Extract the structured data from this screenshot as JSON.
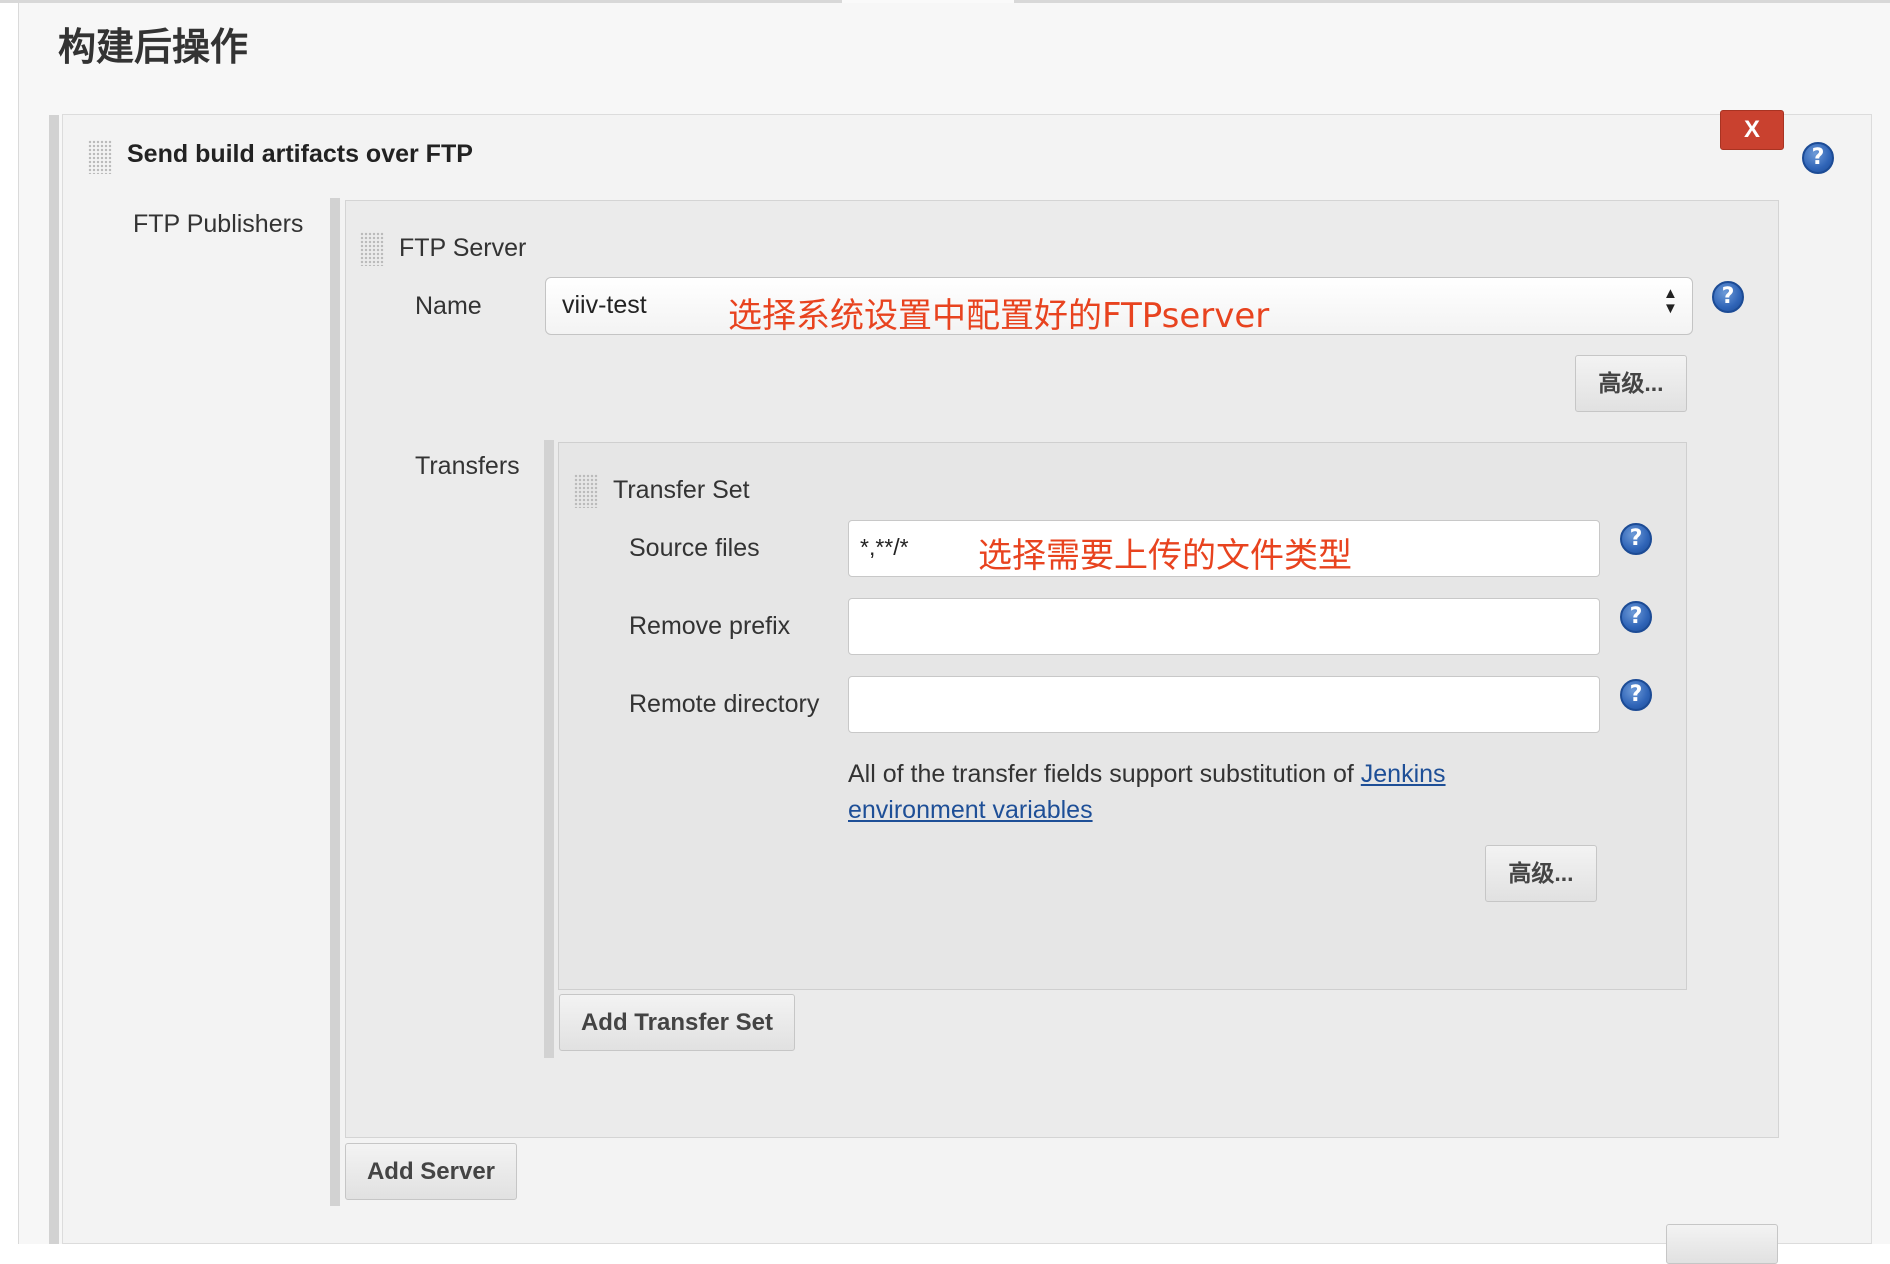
{
  "section": {
    "title": "构建后操作"
  },
  "plugin": {
    "title": "Send build artifacts over FTP",
    "delete_label": "X"
  },
  "ftp_publishers": {
    "label": "FTP Publishers"
  },
  "ftp_server": {
    "title": "FTP Server",
    "name_label": "Name",
    "name_value": "viiv-test",
    "name_annotation": "选择系统设置中配置好的FTPserver",
    "advanced_label": "高级..."
  },
  "transfers": {
    "label": "Transfers",
    "set_title": "Transfer Set",
    "source_files_label": "Source files",
    "source_files_value": "*,**/*",
    "source_files_annotation": "选择需要上传的文件类型",
    "remove_prefix_label": "Remove prefix",
    "remove_prefix_value": "",
    "remote_directory_label": "Remote directory",
    "remote_directory_value": "",
    "note_text": "All of the transfer fields support substitution of ",
    "note_link_1": "Jenkins",
    "note_link_2": "environment variables",
    "advanced_label": "高级...",
    "add_set_label": "Add Transfer Set"
  },
  "add_server_label": "Add Server",
  "help_icon_glyph": "?",
  "colors": {
    "delete_button": "#c9412f",
    "annotation": "#e8431f",
    "help_icon": "#2f64b7",
    "link": "#1e4f97"
  }
}
